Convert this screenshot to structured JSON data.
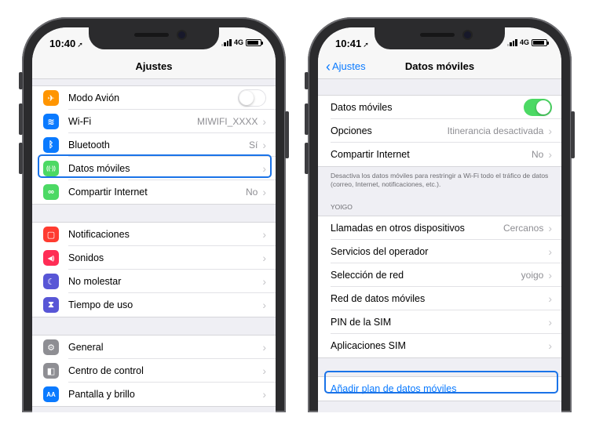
{
  "colors": {
    "accent": "#0a7aff",
    "highlight": "#1a73e8",
    "toggle_on": "#4cd964"
  },
  "left": {
    "status": {
      "time": "10:40",
      "network": "4G"
    },
    "title": "Ajustes",
    "groups": [
      [
        {
          "label": "Modo Avión",
          "icon": "airplane-icon",
          "icon_color": "#ff9500",
          "toggle": "off"
        },
        {
          "label": "Wi-Fi",
          "icon": "wifi-icon",
          "icon_color": "#0a7aff",
          "value": "MIWIFI_XXXX"
        },
        {
          "label": "Bluetooth",
          "icon": "bluetooth-icon",
          "icon_color": "#0a7aff",
          "value": "Sí"
        },
        {
          "label": "Datos móviles",
          "icon": "cellular-antenna-icon",
          "icon_color": "#4cd964",
          "value": ""
        },
        {
          "label": "Compartir Internet",
          "icon": "hotspot-link-icon",
          "icon_color": "#4cd964",
          "value": "No"
        }
      ],
      [
        {
          "label": "Notificaciones",
          "icon": "notifications-icon",
          "icon_color": "#ff3b30"
        },
        {
          "label": "Sonidos",
          "icon": "speaker-icon",
          "icon_color": "#ff2d55"
        },
        {
          "label": "No molestar",
          "icon": "moon-icon",
          "icon_color": "#5856d6"
        },
        {
          "label": "Tiempo de uso",
          "icon": "hourglass-icon",
          "icon_color": "#5856d6"
        }
      ],
      [
        {
          "label": "General",
          "icon": "gear-icon",
          "icon_color": "#8e8e93"
        },
        {
          "label": "Centro de control",
          "icon": "switches-icon",
          "icon_color": "#8e8e93"
        },
        {
          "label": "Pantalla y brillo",
          "icon": "text-size-icon",
          "icon_color": "#0a7aff"
        }
      ]
    ]
  },
  "right": {
    "status": {
      "time": "10:41",
      "network": "4G"
    },
    "back_label": "Ajustes",
    "title": "Datos móviles",
    "group1": [
      {
        "label": "Datos móviles",
        "toggle": "on"
      },
      {
        "label": "Opciones",
        "value": "Itinerancia desactivada"
      },
      {
        "label": "Compartir Internet",
        "value": "No"
      }
    ],
    "footer": "Desactiva los datos móviles para restringir a Wi-Fi todo el tráfico de datos (correo, Internet, notificaciones, etc.).",
    "section_header": "YOIGO",
    "group2": [
      {
        "label": "Llamadas en otros dispositivos",
        "value": "Cercanos"
      },
      {
        "label": "Servicios del operador",
        "value": ""
      },
      {
        "label": "Selección de red",
        "value": "yoigo"
      },
      {
        "label": "Red de datos móviles",
        "value": ""
      },
      {
        "label": "PIN de la SIM",
        "value": ""
      },
      {
        "label": "Aplicaciones SIM",
        "value": ""
      }
    ],
    "add_plan": "Añadir plan de datos móviles"
  }
}
